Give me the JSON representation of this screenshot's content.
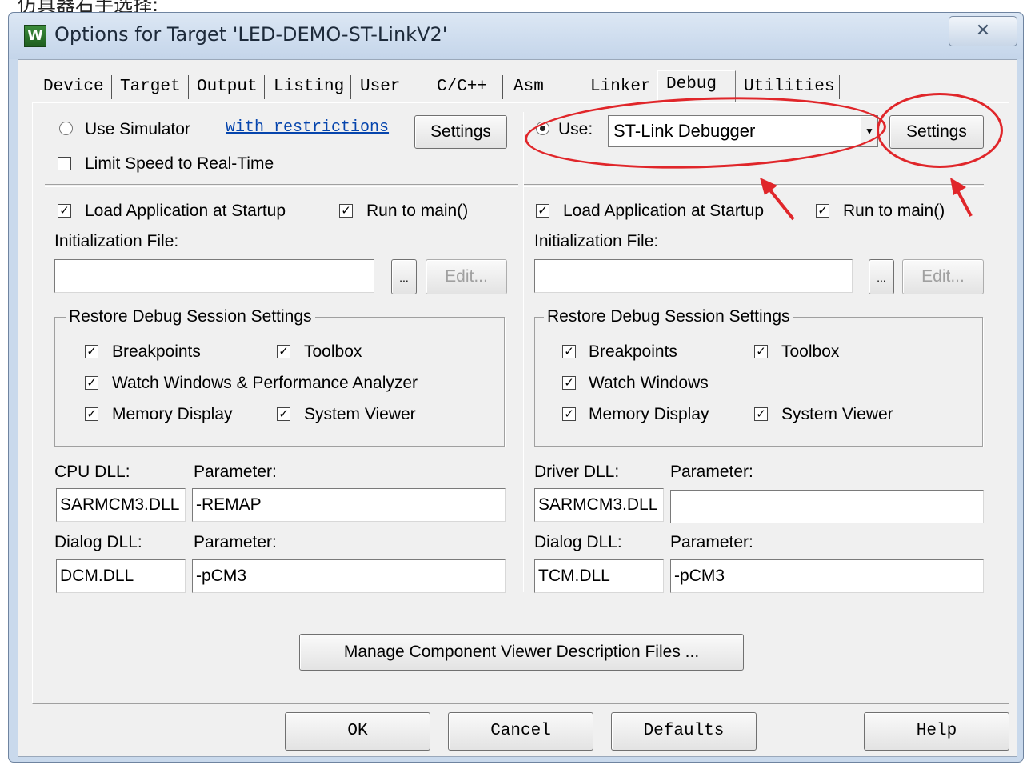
{
  "caption": "仿真器右手选择:",
  "window": {
    "title": "Options for Target 'LED-DEMO-ST-LinkV2'",
    "icon_letter": "W",
    "close_glyph": "✕"
  },
  "tabs": [
    "Device",
    "Target",
    "Output",
    "Listing",
    "User",
    "C/C++",
    "Asm",
    "Linker",
    "Debug",
    "Utilities"
  ],
  "active_tab": "Debug",
  "left": {
    "use_simulator_label": "Use Simulator",
    "use_simulator_selected": false,
    "restrictions_link": "with restrictions",
    "settings_label": "Settings",
    "limit_speed_label": "Limit Speed to Real-Time",
    "load_app_label": "Load Application at Startup",
    "run_to_main_label": "Run to main()",
    "init_file_label": "Initialization File:",
    "init_file_value": "",
    "browse_label": "...",
    "edit_label": "Edit...",
    "restore_group_title": "Restore Debug Session Settings",
    "breakpoints_label": "Breakpoints",
    "toolbox_label": "Toolbox",
    "watch_label": "Watch Windows & Performance Analyzer",
    "memory_label": "Memory Display",
    "system_viewer_label": "System Viewer",
    "cpu_dll_label": "CPU DLL:",
    "cpu_param_label": "Parameter:",
    "cpu_dll_value": "SARMCM3.DLL",
    "cpu_param_value": "-REMAP",
    "dialog_dll_label": "Dialog DLL:",
    "dialog_param_label": "Parameter:",
    "dialog_dll_value": "DCM.DLL",
    "dialog_param_value": "-pCM3"
  },
  "right": {
    "use_label": "Use:",
    "use_selected": true,
    "debugger_value": "ST-Link Debugger",
    "settings_label": "Settings",
    "load_app_label": "Load Application at Startup",
    "run_to_main_label": "Run to main()",
    "init_file_label": "Initialization File:",
    "init_file_value": "",
    "browse_label": "...",
    "edit_label": "Edit...",
    "restore_group_title": "Restore Debug Session Settings",
    "breakpoints_label": "Breakpoints",
    "toolbox_label": "Toolbox",
    "watch_label": "Watch Windows",
    "memory_label": "Memory Display",
    "system_viewer_label": "System Viewer",
    "driver_dll_label": "Driver DLL:",
    "driver_param_label": "Parameter:",
    "driver_dll_value": "SARMCM3.DLL",
    "driver_param_value": "",
    "dialog_dll_label": "Dialog DLL:",
    "dialog_param_label": "Parameter:",
    "dialog_dll_value": "TCM.DLL",
    "dialog_param_value": "-pCM3"
  },
  "checkmark": "✓",
  "combo_arrow": "▼",
  "manage_label": "Manage Component Viewer Description Files ...",
  "footer": {
    "ok": "OK",
    "cancel": "Cancel",
    "defaults": "Defaults",
    "help": "Help"
  },
  "annotation_color": "#e0262a"
}
